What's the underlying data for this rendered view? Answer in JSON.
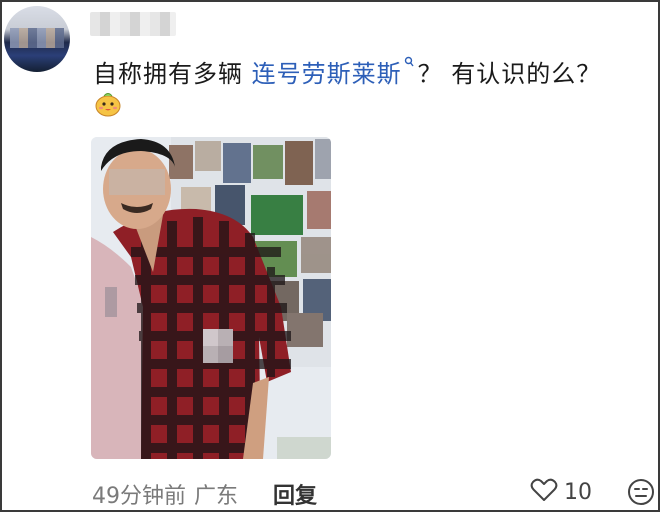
{
  "comment": {
    "text_prefix": "自称拥有多辆 ",
    "link_text": "连号劳斯莱斯",
    "text_suffix": "？ 有认识的么？"
  },
  "footer": {
    "time": "49分钟前",
    "location": "广东",
    "reply_label": "回复",
    "like_count": "10"
  },
  "icons": {
    "search_mark": "search-icon",
    "sticker": "smiling-emoji-sticker",
    "like": "heart-outline-icon",
    "react": "expressionless-face-icon"
  },
  "colors": {
    "link": "#2d5fb8",
    "meta": "#7a7a7a"
  }
}
